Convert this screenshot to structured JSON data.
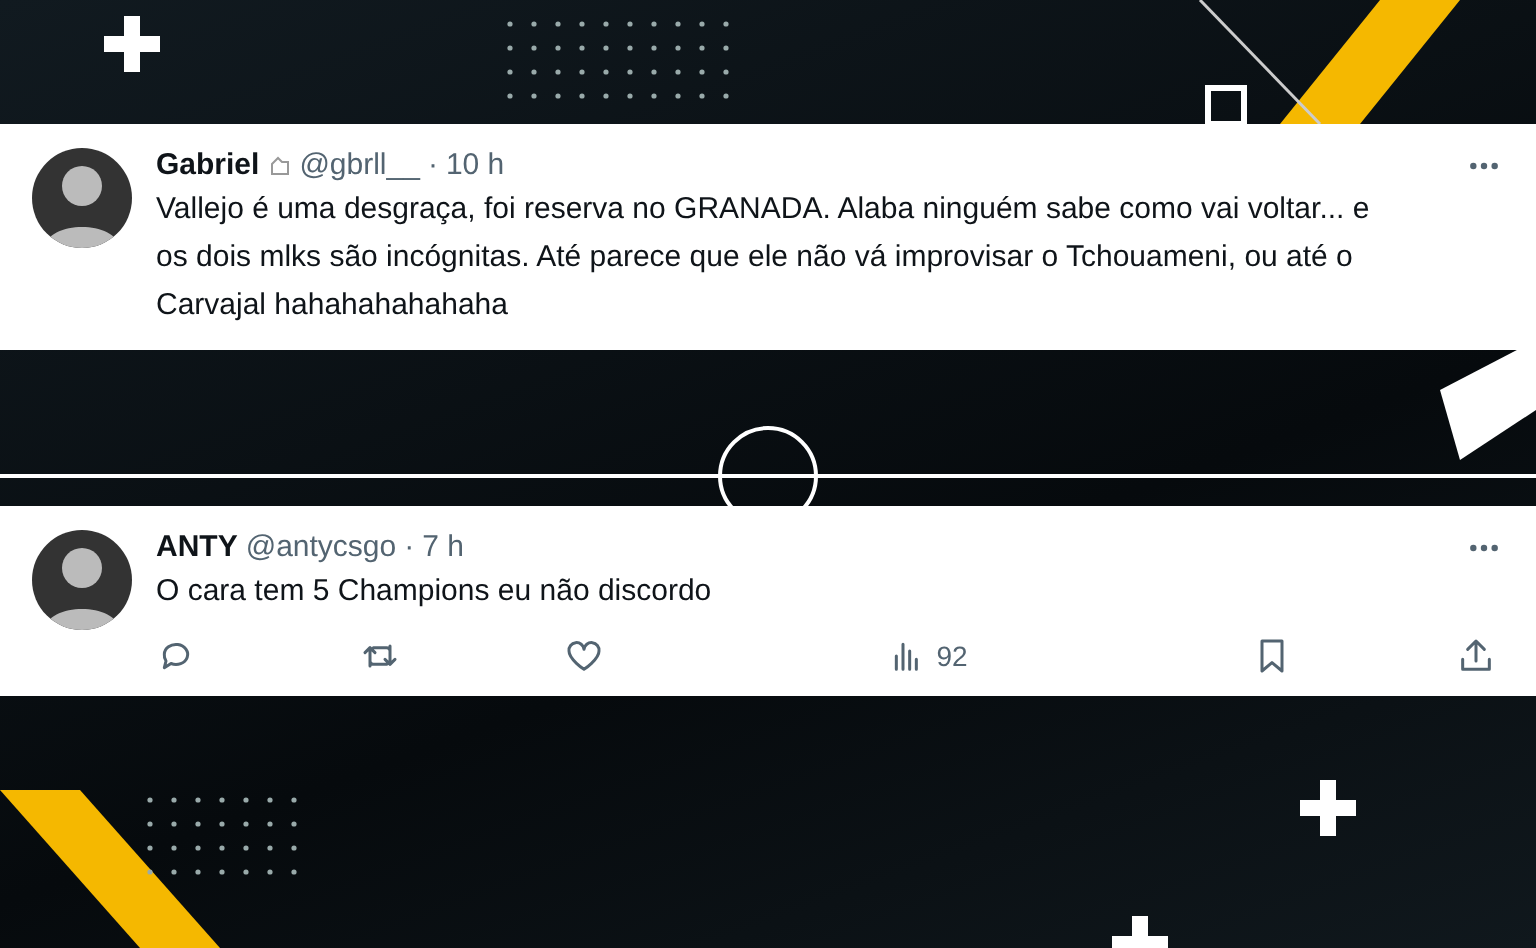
{
  "tweets": [
    {
      "name": "Gabriel",
      "badge_icon": true,
      "handle": "@gbrll__",
      "separator": "·",
      "time": "10 h",
      "text": "Vallejo é uma desgraça, foi reserva no GRANADA. Alaba ninguém sabe como vai voltar... e os dois mlks são incógnitas. Até parece que ele não vá improvisar o Tchouameni, ou até o Carvajal hahahahahahaha"
    },
    {
      "name": "ANTY",
      "badge_icon": false,
      "handle": "@antycsgo",
      "separator": "·",
      "time": "7 h",
      "text": "O cara tem 5 Champions eu não discordo",
      "actions": [
        {
          "kind": "reply"
        },
        {
          "kind": "retweet"
        },
        {
          "kind": "like"
        },
        {
          "kind": "views",
          "count": "92"
        },
        {
          "kind": "bookmark"
        },
        {
          "kind": "share"
        }
      ]
    }
  ]
}
